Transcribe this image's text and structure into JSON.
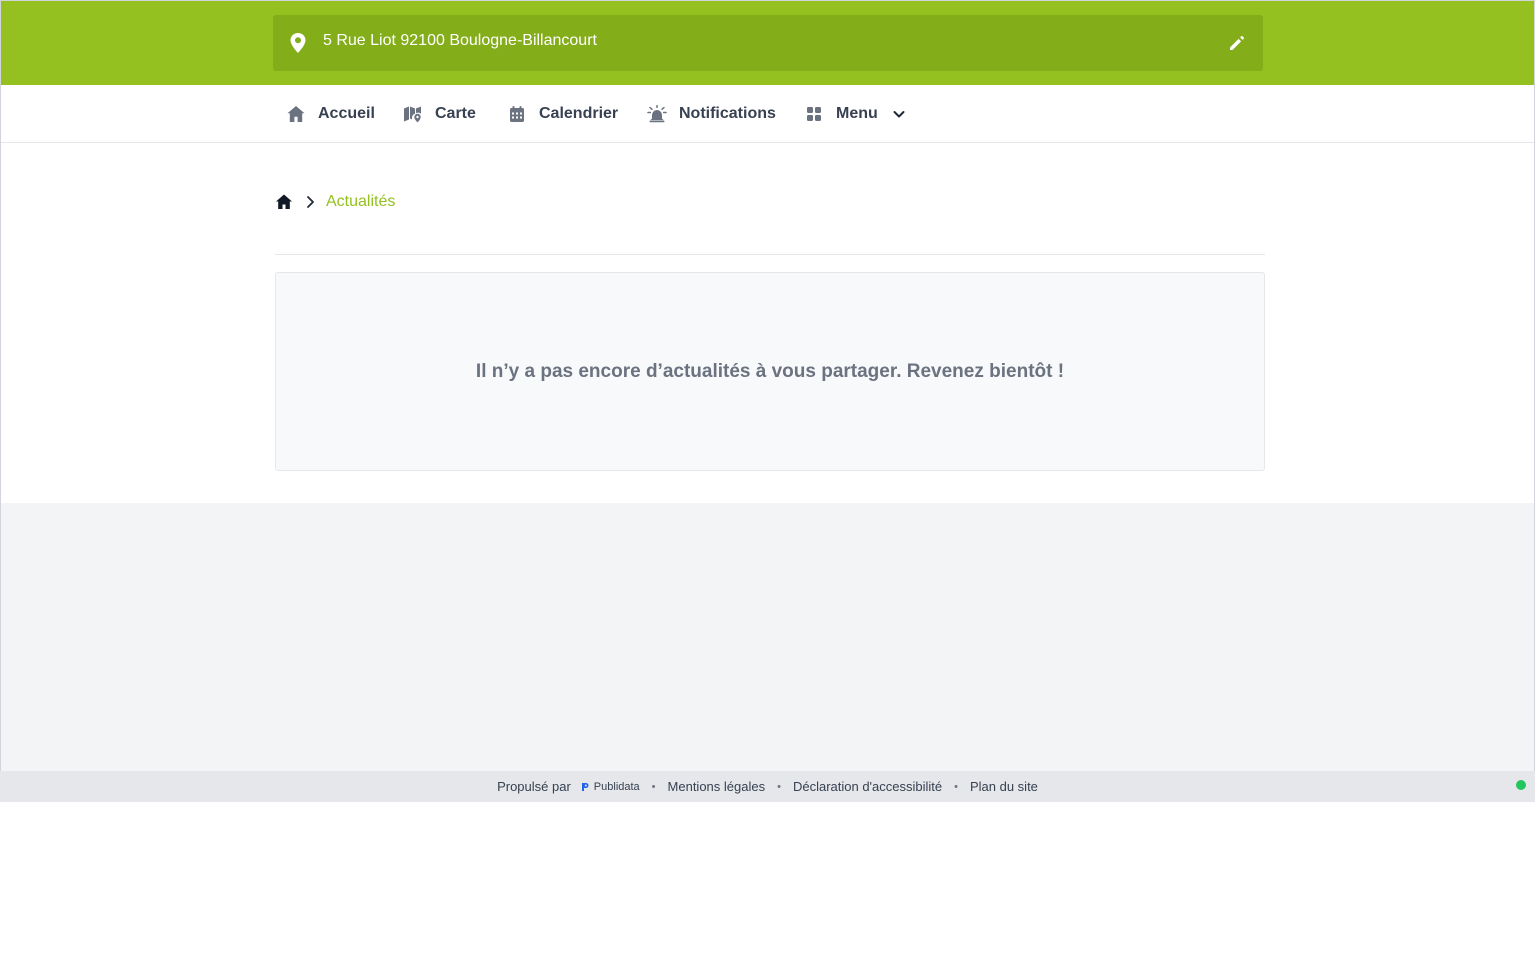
{
  "header": {
    "address": "5 Rue Liot 92100 Boulogne-Billancourt",
    "address_icon": "map-pin-icon",
    "edit_icon": "pencil-icon",
    "brand_color": "#94c11f"
  },
  "nav": {
    "items": [
      {
        "label": "Accueil",
        "icon": "home-icon"
      },
      {
        "label": "Carte",
        "icon": "map-icon"
      },
      {
        "label": "Calendrier",
        "icon": "calendar-icon"
      },
      {
        "label": "Notifications",
        "icon": "alarm-bell-icon"
      },
      {
        "label": "Menu",
        "icon": "grid-icon",
        "has_dropdown": true
      }
    ]
  },
  "breadcrumb": {
    "home_icon": "home-icon",
    "current": "Actualités"
  },
  "main": {
    "empty_message": "Il n’y a pas encore d’actualités à vous partager. Revenez bientôt !"
  },
  "footer": {
    "powered_by": "Propulsé par",
    "brand": "Publidata",
    "links": [
      "Mentions légales",
      "Déclaration d'accessibilité",
      "Plan du site"
    ],
    "status_color": "#22c55e"
  }
}
